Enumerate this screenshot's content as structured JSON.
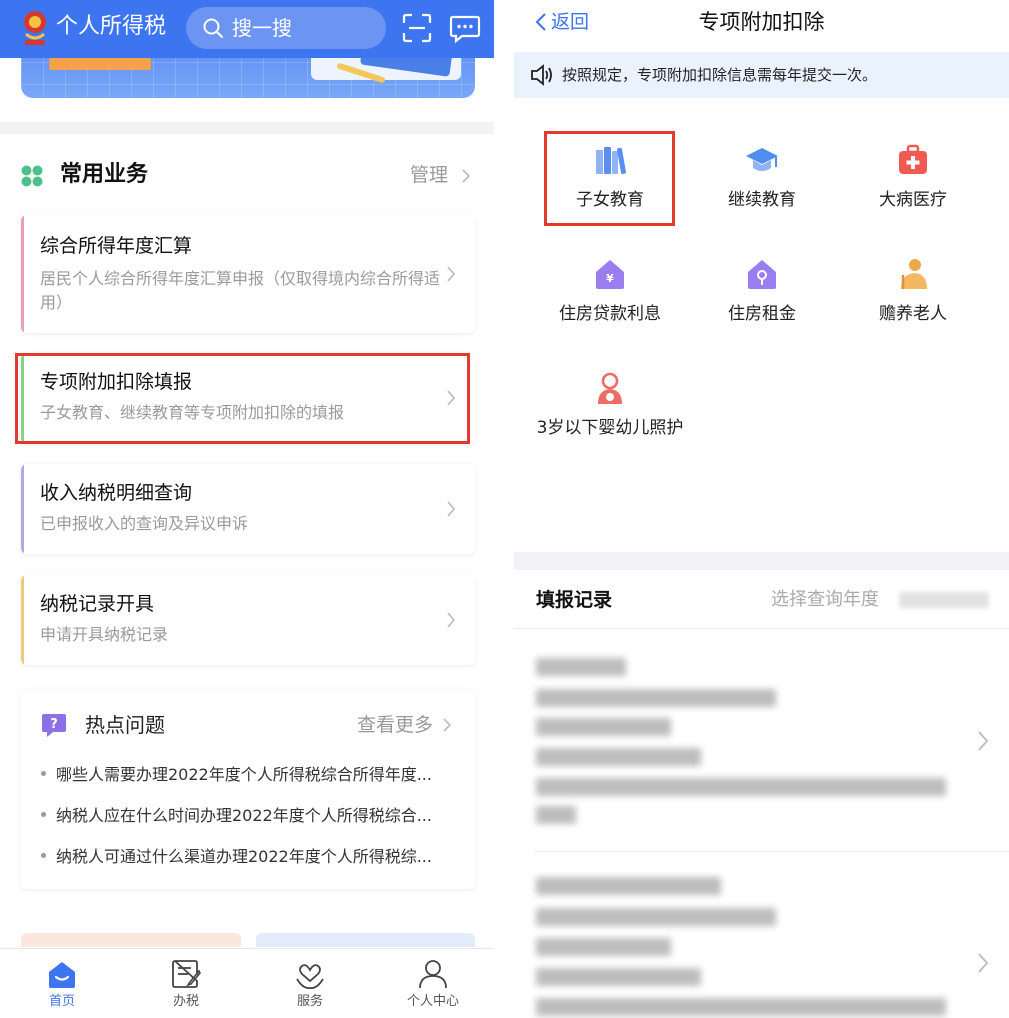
{
  "left": {
    "header": {
      "app_title": "个人所得税",
      "search_placeholder": "搜一搜"
    },
    "common_services": {
      "title": "常用业务",
      "manage_label": "管理",
      "cards": [
        {
          "title": "综合所得年度汇算",
          "desc": "居民个人综合所得年度汇算申报（仅取得境内综合所得适用）",
          "accent": "#e8a1b3"
        },
        {
          "title": "专项附加扣除填报",
          "desc": "子女教育、继续教育等专项附加扣除的填报",
          "accent": "#8ccf8a"
        },
        {
          "title": "收入纳税明细查询",
          "desc": "已申报收入的查询及异议申诉",
          "accent": "#b5a6ec"
        },
        {
          "title": "纳税记录开具",
          "desc": "申请开具纳税记录",
          "accent": "#f0c87a"
        }
      ]
    },
    "hot_questions": {
      "title": "热点问题",
      "more_label": "查看更多",
      "items": [
        "哪些人需要办理2022年度个人所得税综合所得年度...",
        "纳税人应在什么时间办理2022年度个人所得税综合...",
        "纳税人可通过什么渠道办理2022年度个人所得税综..."
      ]
    },
    "tabbar": [
      {
        "label": "首页",
        "icon": "home-icon",
        "active": true
      },
      {
        "label": "办税",
        "icon": "tax-form-icon",
        "active": false
      },
      {
        "label": "服务",
        "icon": "heart-hand-icon",
        "active": false
      },
      {
        "label": "个人中心",
        "icon": "user-icon",
        "active": false
      }
    ]
  },
  "right": {
    "nav": {
      "back_label": "返回",
      "title": "专项附加扣除"
    },
    "notice": "按照规定，专项附加扣除信息需每年提交一次。",
    "categories": [
      {
        "label": "子女教育",
        "icon": "books-icon",
        "color": "#5a8ff0"
      },
      {
        "label": "继续教育",
        "icon": "graduation-cap-icon",
        "color": "#4f8ef0"
      },
      {
        "label": "大病医疗",
        "icon": "medical-kit-icon",
        "color": "#ef5b52"
      },
      {
        "label": "住房贷款利息",
        "icon": "house-yen-icon",
        "color": "#9a7ef0"
      },
      {
        "label": "住房租金",
        "icon": "house-key-icon",
        "color": "#9a7ef0"
      },
      {
        "label": "赡养老人",
        "icon": "elder-icon",
        "color": "#f0a64a"
      },
      {
        "label": "3岁以下婴幼儿照护",
        "icon": "baby-care-icon",
        "color": "#ef6b66"
      }
    ],
    "records": {
      "title": "填报记录",
      "year_selector_label": "选择查询年度"
    }
  },
  "theme": {
    "primary": "#3d74f0",
    "highlight_border": "#e23a2c"
  }
}
